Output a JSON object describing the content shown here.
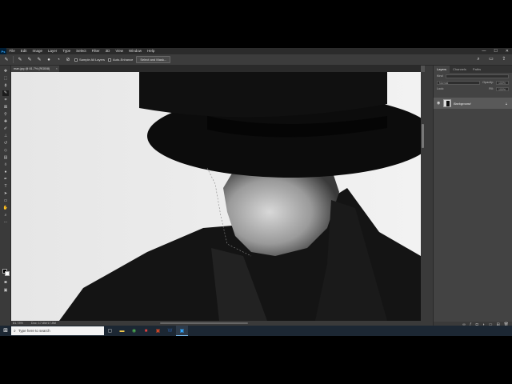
{
  "menubar": {
    "app_logo": "Ps",
    "items": [
      "File",
      "Edit",
      "Image",
      "Layer",
      "Type",
      "Select",
      "Filter",
      "3D",
      "View",
      "Window",
      "Help"
    ],
    "controls": [
      "—",
      "☐",
      "✕"
    ]
  },
  "options": {
    "sample_all_layers": "Sample All Layers",
    "auto_enhance": "Auto-Enhance",
    "select_and_mask": "Select and Mask..."
  },
  "document": {
    "tab_label": "man.jpg @ 81.7% (RGB/8)",
    "close": "×"
  },
  "status": {
    "zoom": "81.73%",
    "doc_info": "Doc: 17.8M/17.8M"
  },
  "layers_panel": {
    "tabs": [
      "Layers",
      "Channels",
      "Paths"
    ],
    "kind_label": "Kind",
    "blend_mode": "Normal",
    "opacity_label": "Opacity:",
    "opacity": "100%",
    "lock_label": "Lock:",
    "fill_label": "Fill:",
    "fill": "100%",
    "layer_name": "Background"
  },
  "taskbar": {
    "search_placeholder": "Type here to search",
    "apps": [
      "task-view",
      "file-explorer",
      "chrome",
      "app-red",
      "powerpoint",
      "word",
      "photoshop"
    ]
  }
}
